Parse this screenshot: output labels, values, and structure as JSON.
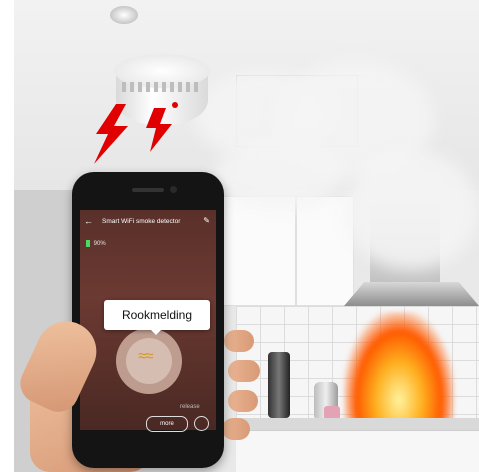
{
  "app": {
    "title": "Smart WiFi smoke detector",
    "battery": "90%",
    "alert": "Rookmelding",
    "bottom_text": "release",
    "more_label": "more"
  },
  "icons": {
    "back": "arrow-left-icon",
    "edit": "pencil-icon",
    "battery": "battery-icon",
    "smoke": "smoke-icon"
  },
  "colors": {
    "screen_bg": "#5a302a",
    "alert_bg": "#ffffff",
    "bolt": "#e00000",
    "fire": "#ff5a00"
  }
}
